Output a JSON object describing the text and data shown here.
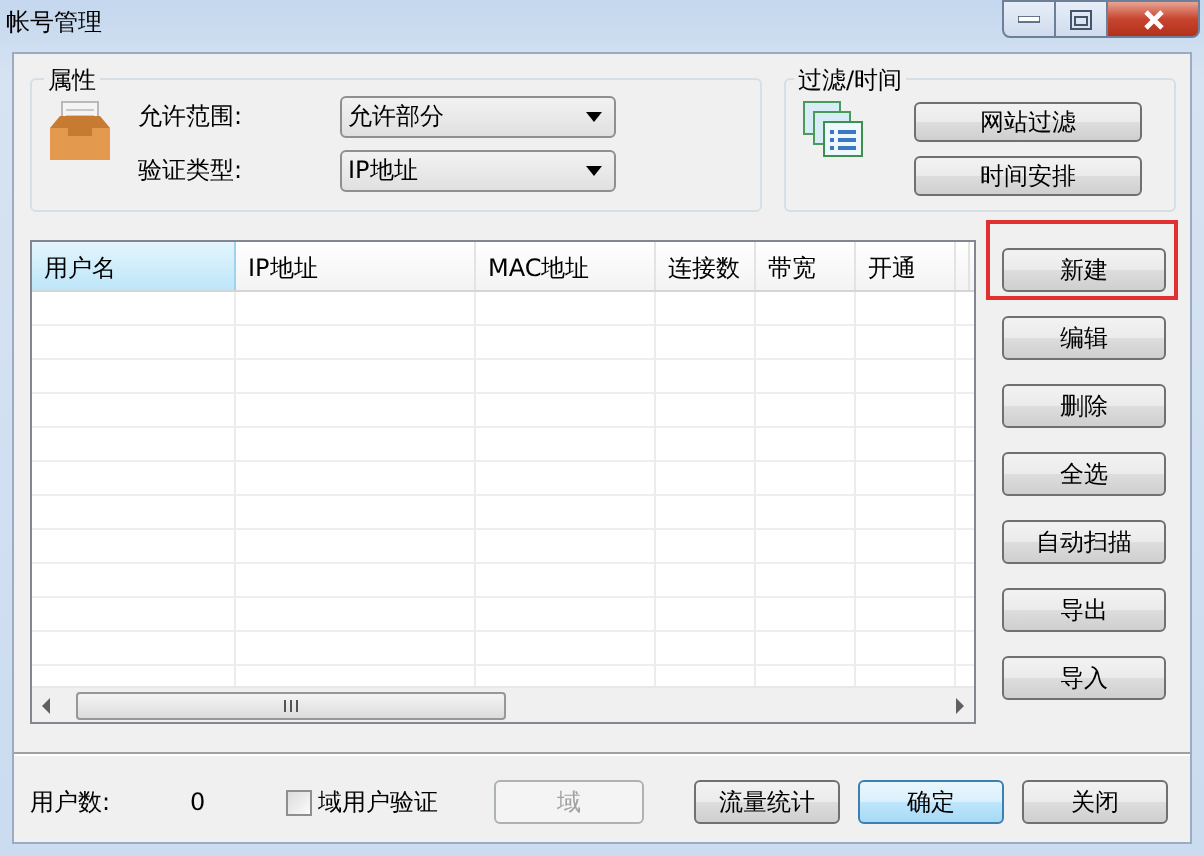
{
  "window": {
    "title": "帐号管理"
  },
  "properties": {
    "title": "属性",
    "fields": [
      {
        "label": "允许范围:",
        "value": "允许部分"
      },
      {
        "label": "验证类型:",
        "value": "IP地址"
      }
    ]
  },
  "filter": {
    "title": "过滤/时间",
    "buttons": [
      "网站过滤",
      "时间安排"
    ]
  },
  "table": {
    "columns": [
      {
        "label": "用户名",
        "selected": true
      },
      {
        "label": "IP地址",
        "selected": false
      },
      {
        "label": "MAC地址",
        "selected": false
      },
      {
        "label": "连接数",
        "selected": false
      },
      {
        "label": "带宽",
        "selected": false
      },
      {
        "label": "开通",
        "selected": false
      }
    ]
  },
  "actions": [
    {
      "label": "新建",
      "highlighted": true
    },
    {
      "label": "编辑",
      "highlighted": false
    },
    {
      "label": "删除",
      "highlighted": false
    },
    {
      "label": "全选",
      "highlighted": false
    },
    {
      "label": "自动扫描",
      "highlighted": false
    },
    {
      "label": "导出",
      "highlighted": false
    },
    {
      "label": "导入",
      "highlighted": false
    }
  ],
  "footer": {
    "user_count_label": "用户数:",
    "user_count": "0",
    "domain_check": {
      "label": "域用户验证",
      "checked": false
    },
    "buttons": [
      {
        "label": "域",
        "disabled": true,
        "default": false
      },
      {
        "label": "流量统计",
        "disabled": false,
        "default": false
      },
      {
        "label": "确定",
        "disabled": false,
        "default": true
      },
      {
        "label": "关闭",
        "disabled": false,
        "default": false
      }
    ]
  }
}
